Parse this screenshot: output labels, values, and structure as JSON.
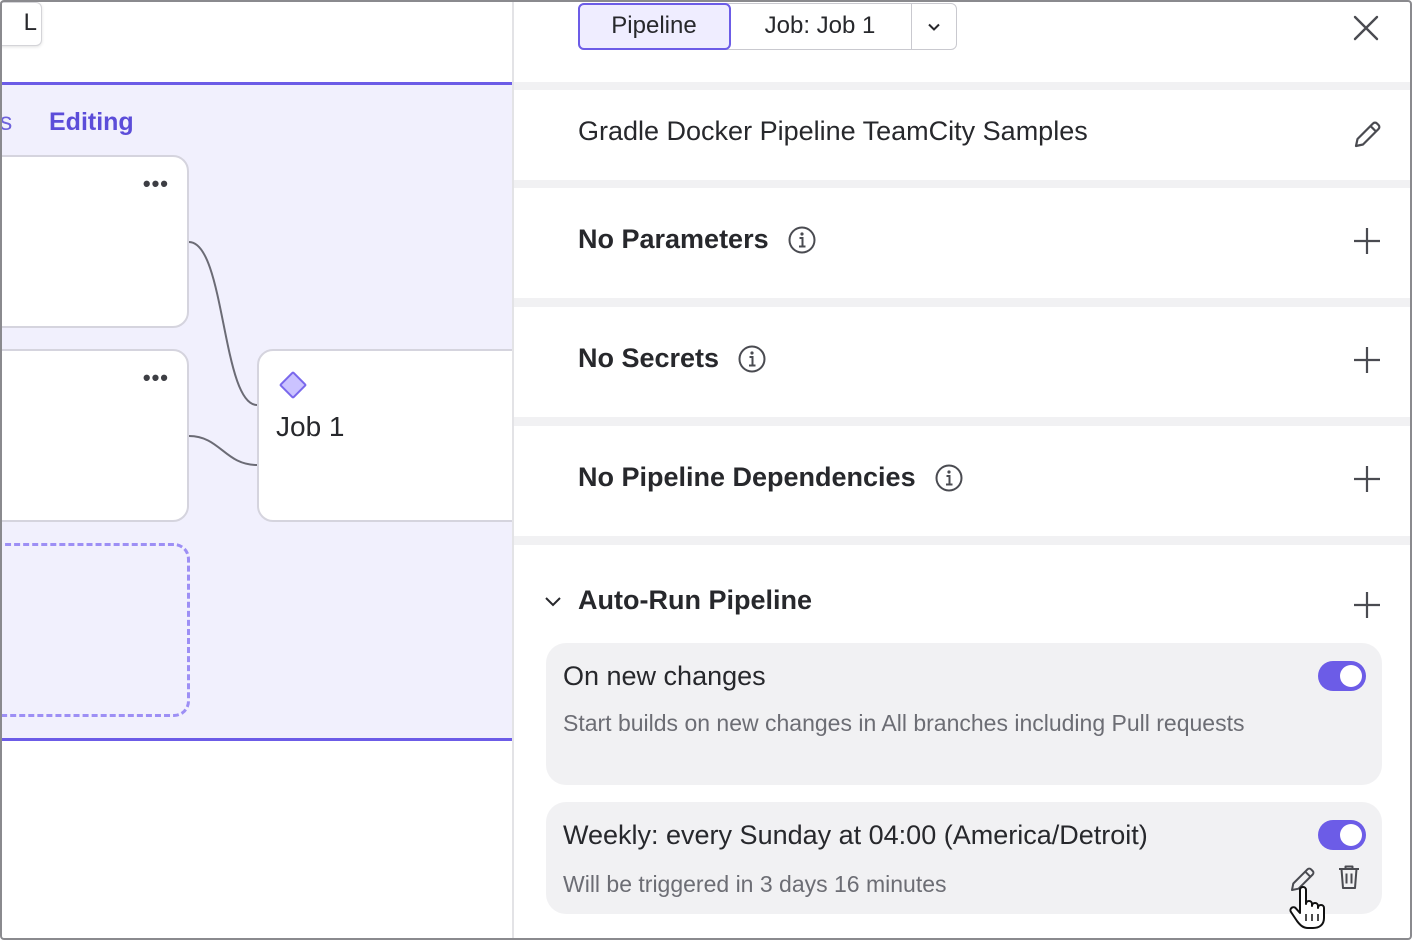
{
  "canvas": {
    "top_stub_text": "L",
    "stage_tab_clipped": "ngs",
    "stage_tab_editing": "Editing",
    "more_menu_glyph": "•••",
    "job_card_title": "Job 1"
  },
  "panel": {
    "tabs": {
      "pipeline_label": "Pipeline",
      "job_label": "Job: Job 1"
    },
    "pipeline_name": "Gradle Docker Pipeline TeamCity Samples",
    "sections": {
      "parameters": "No Parameters",
      "secrets": "No Secrets",
      "dependencies": "No Pipeline Dependencies"
    },
    "auto_run": {
      "title": "Auto-Run Pipeline",
      "triggers": [
        {
          "title": "On new changes",
          "description": "Start builds on new changes in All branches including Pull requests",
          "enabled": true
        },
        {
          "title": "Weekly: every Sunday at 04:00 (America/Detroit)",
          "description": "Will be triggered in 3 days 16 minutes",
          "enabled": true
        }
      ]
    }
  },
  "colors": {
    "accent": "#6c5ce7",
    "stage_bg": "#f1f0fd",
    "panel_bg": "#f1f1f3",
    "text": "#27282c",
    "muted_text": "#6c6d74"
  },
  "icons": [
    "chevron-down-icon",
    "close-icon",
    "pencil-icon",
    "info-icon",
    "plus-icon",
    "trash-icon",
    "diamond-icon",
    "hand-cursor-icon"
  ]
}
